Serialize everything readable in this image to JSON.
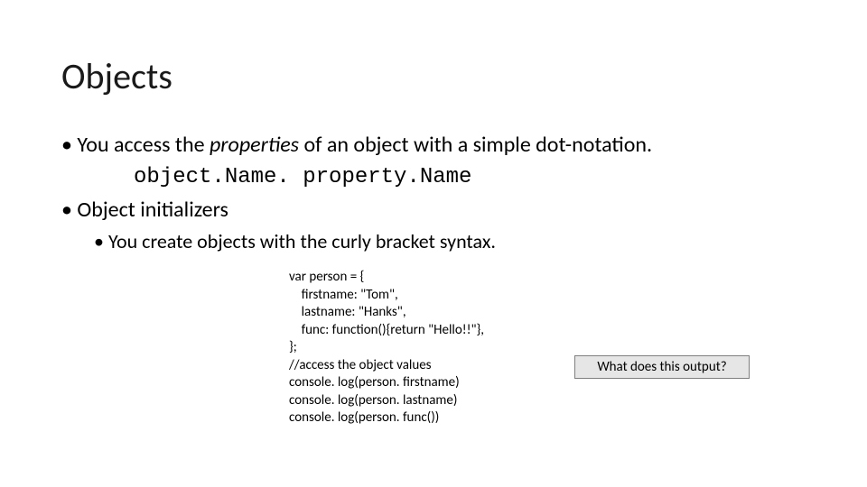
{
  "title": "Objects",
  "bullets": [
    {
      "prefix": "You access the ",
      "italic": "properties",
      "suffix": " of an object with a simple dot-notation.",
      "code": "object.Name. property.Name"
    },
    {
      "text": "Object initializers",
      "sub": [
        "You create objects with the curly bracket syntax."
      ]
    }
  ],
  "code_block": "var person = {\n    firstname: \"Tom\",\n    lastname: \"Hanks\",\n    func: function(){return \"Hello!!\"},\n};\n//access the object values\nconsole. log(person. firstname)\nconsole. log(person. lastname)\nconsole. log(person. func())",
  "callout": "What does this output?"
}
